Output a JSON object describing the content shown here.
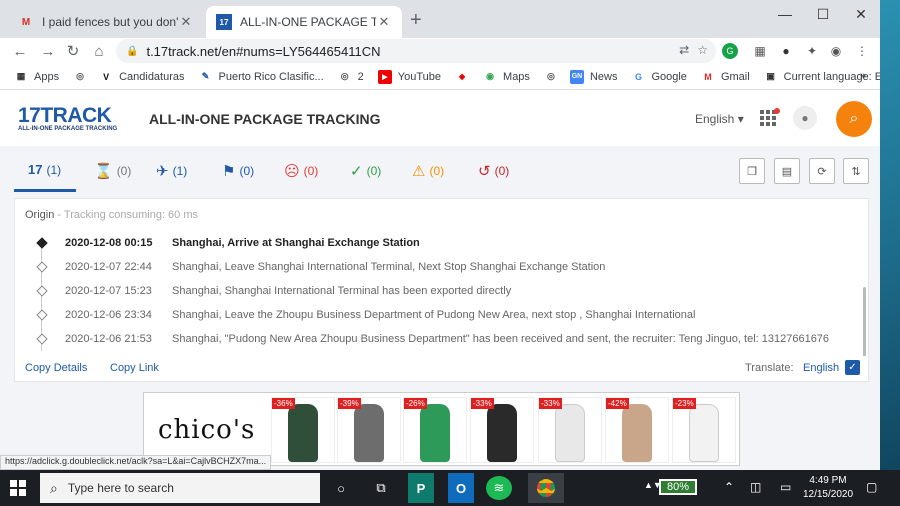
{
  "browser": {
    "tabs": [
      {
        "title": "I paid fences but you don't send",
        "favicon": "gmail-icon",
        "active": false
      },
      {
        "title": "ALL-IN-ONE PACKAGE TRACKING",
        "favicon": "17track-icon",
        "active": true
      }
    ],
    "new_tab": "+",
    "window_controls": [
      "minimize",
      "maximize",
      "close"
    ],
    "url": "t.17track.net/en#nums=LY564465411CN",
    "bookmarks": [
      {
        "label": "Apps",
        "icon": "apps-icon"
      },
      {
        "label": "",
        "icon": "globe-icon"
      },
      {
        "label": "Candidaturas",
        "icon": "v-icon"
      },
      {
        "label": "Puerto Rico  Clasific...",
        "icon": "pr-icon"
      },
      {
        "label": "2",
        "icon": "globe-icon"
      },
      {
        "label": "YouTube",
        "icon": "youtube-icon"
      },
      {
        "label": "",
        "icon": "tag-icon"
      },
      {
        "label": "Maps",
        "icon": "maps-icon"
      },
      {
        "label": "",
        "icon": "globe-icon"
      },
      {
        "label": "News",
        "icon": "news-icon"
      },
      {
        "label": "Google",
        "icon": "google-icon"
      },
      {
        "label": "Gmail",
        "icon": "gmail-icon"
      },
      {
        "label": "Current language: E...",
        "icon": "language-icon"
      }
    ],
    "more_bookmarks": "»"
  },
  "site": {
    "logo_top": "17TRACK",
    "logo_bottom": "ALL-IN-ONE PACKAGE TRACKING",
    "title": "ALL-IN-ONE PACKAGE TRACKING",
    "language": "English",
    "accent": "#f5820d",
    "brand": "#1e5aa8"
  },
  "status_tabs": [
    {
      "icon": "17-icon",
      "count": "(1)",
      "color": "#1e5aa8"
    },
    {
      "icon": "hourglass-icon",
      "count": "(0)",
      "color": "#555555"
    },
    {
      "icon": "plane-icon",
      "count": "(1)",
      "color": "#1e5aa8"
    },
    {
      "icon": "flag-icon",
      "count": "(0)",
      "color": "#1e5aa8"
    },
    {
      "icon": "sad-face-icon",
      "count": "(0)",
      "color": "#e53935"
    },
    {
      "icon": "check-icon",
      "count": "(0)",
      "color": "#2e9e44"
    },
    {
      "icon": "warning-icon",
      "count": "(0)",
      "color": "#f29100"
    },
    {
      "icon": "history-icon",
      "count": "(0)",
      "color": "#c62828"
    }
  ],
  "tracking": {
    "origin_label": "Origin",
    "origin_sub": " - Tracking consuming: 60 ms",
    "events": [
      {
        "time": "2020-12-08 00:15",
        "desc": "Shanghai, Arrive at Shanghai Exchange Station"
      },
      {
        "time": "2020-12-07 22:44",
        "desc": "Shanghai, Leave Shanghai International Terminal, Next Stop Shanghai Exchange Station"
      },
      {
        "time": "2020-12-07 15:23",
        "desc": "Shanghai, Shanghai International Terminal has been exported directly"
      },
      {
        "time": "2020-12-06 23:34",
        "desc": "Shanghai, Leave the Zhoupu Business Department of Pudong New Area, next stop , Shanghai International"
      },
      {
        "time": "2020-12-06 21:53",
        "desc": "Shanghai, \"Pudong New Area Zhoupu Business Department\" has been received and sent, the recruiter: Teng Jinguo, tel: 13127661676"
      }
    ],
    "copy_details": "Copy Details",
    "copy_link": "Copy Link",
    "translate_label": "Translate:",
    "translate_value": "English"
  },
  "ad": {
    "brand": "chico's",
    "products": [
      {
        "discount": "-36%",
        "color": "#2f4f3a"
      },
      {
        "discount": "-39%",
        "color": "#6d6d6d"
      },
      {
        "discount": "-26%",
        "color": "#2e9a5a"
      },
      {
        "discount": "-33%",
        "color": "#2a2a2a"
      },
      {
        "discount": "-33%",
        "color": "#e8e8e8"
      },
      {
        "discount": "-42%",
        "color": "#c9a58a"
      },
      {
        "discount": "-23%",
        "color": "#f2f2f2"
      }
    ]
  },
  "status_url": "https://adclick.g.doubleclick.net/aclk?sa=L&ai=CajlvBCHZX7ma...",
  "taskbar": {
    "search_placeholder": "Type here to search",
    "battery": "80%",
    "time": "4:49 PM",
    "date": "12/15/2020"
  }
}
